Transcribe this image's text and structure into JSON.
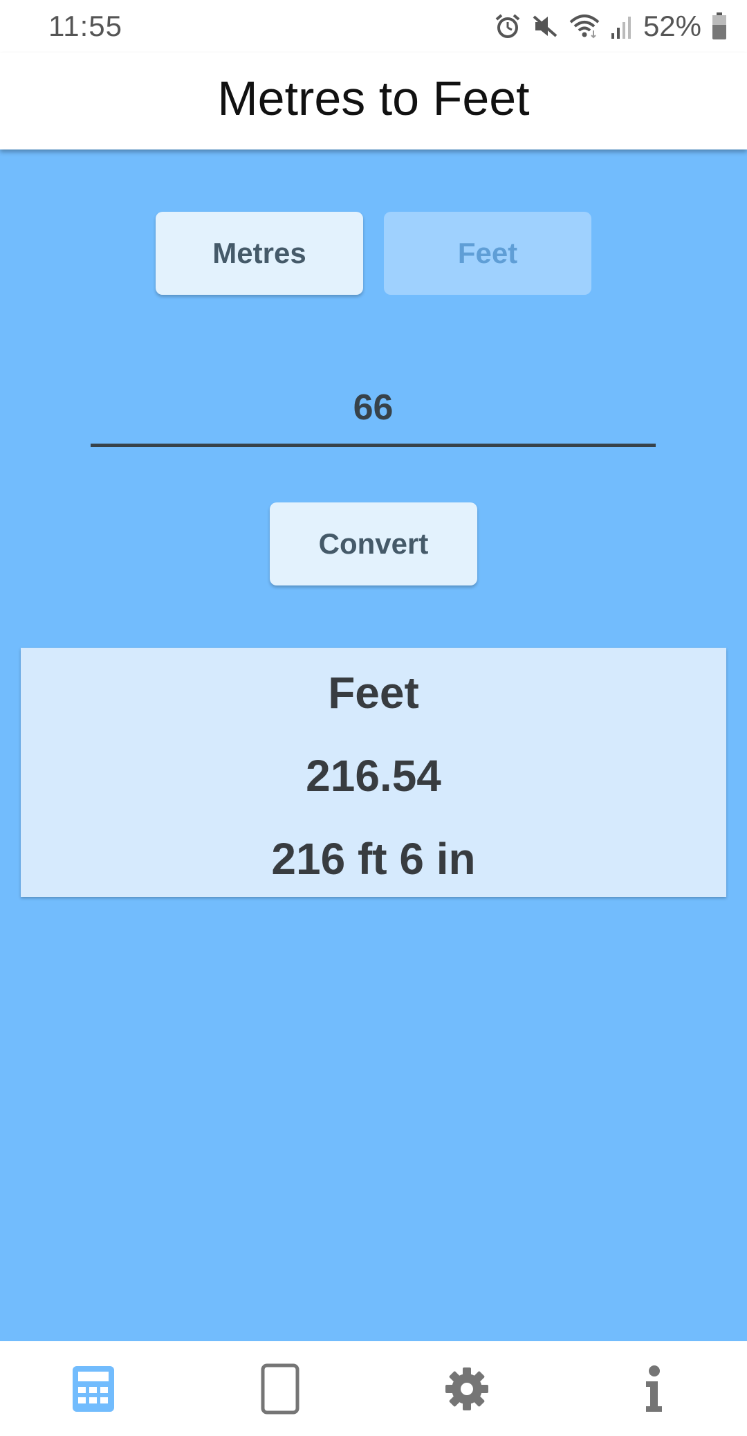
{
  "status_bar": {
    "time": "11:55",
    "battery": "52%",
    "icons": [
      "alarm-icon",
      "mute-icon",
      "wifi-icon",
      "signal-icon",
      "battery-icon"
    ]
  },
  "app_bar": {
    "title": "Metres to Feet"
  },
  "converter": {
    "unit_buttons": [
      {
        "label": "Metres",
        "selected": true
      },
      {
        "label": "Feet",
        "selected": false
      }
    ],
    "input_value": "66",
    "convert_label": "Convert"
  },
  "result": {
    "unit": "Feet",
    "decimal": "216.54",
    "imperial": "216 ft 6 in"
  },
  "bottom_nav": {
    "items": [
      {
        "icon": "calculator-icon",
        "active": true
      },
      {
        "icon": "tablet-icon",
        "active": false
      },
      {
        "icon": "gear-icon",
        "active": false
      },
      {
        "icon": "info-icon",
        "active": false
      }
    ]
  },
  "colors": {
    "background": "#72bcfd",
    "button": "#e3f2fd",
    "button_inactive": "#9fd1fe",
    "result_card": "#d6eafd",
    "text_dark": "#383c40",
    "nav_active": "#72bcfd",
    "nav_inactive": "#757575"
  }
}
